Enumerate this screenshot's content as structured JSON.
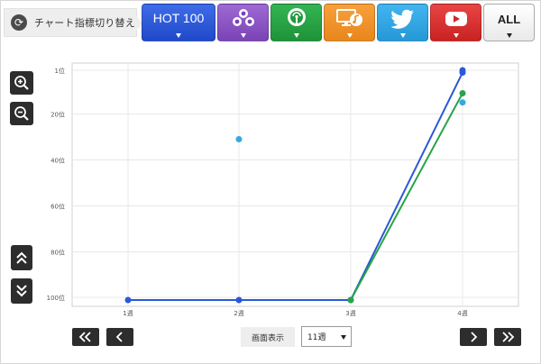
{
  "header": {
    "switch_label": "チャート指標切り替え",
    "tabs": [
      {
        "key": "hot100",
        "label": "HOT 100"
      },
      {
        "key": "person",
        "icon": "people-icon"
      },
      {
        "key": "radio",
        "icon": "radio-antenna-icon"
      },
      {
        "key": "pc",
        "icon": "pc-music-icon"
      },
      {
        "key": "twitter",
        "icon": "twitter-bird-icon"
      },
      {
        "key": "youtube",
        "icon": "youtube-play-icon"
      },
      {
        "key": "all",
        "label": "ALL"
      }
    ],
    "colors": {
      "hot100": "#2a58d8",
      "person": "#8a55c4",
      "radio": "#27a446",
      "pc": "#f09330",
      "twitter": "#34a8e4",
      "youtube": "#d73333"
    }
  },
  "controls": {
    "display_label": "画面表示",
    "display_value": "11週",
    "zoom_in_icon": "zoom-in-icon",
    "zoom_out_icon": "zoom-out-icon",
    "scroll_up_icon": "double-chevron-up-icon",
    "scroll_down_icon": "double-chevron-down-icon"
  },
  "chart_data": {
    "type": "line",
    "categories": [
      "1週",
      "2週",
      "3週",
      "4週"
    ],
    "y_ticks": [
      1,
      20,
      40,
      60,
      80,
      100
    ],
    "y_tick_labels": [
      "1位",
      "20位",
      "40位",
      "60位",
      "80位",
      "100位"
    ],
    "ylim": [
      100,
      1
    ],
    "y_inverted": true,
    "grid": true,
    "legend": "none",
    "series": [
      {
        "color": "#2a58d8",
        "line": true,
        "values": [
          101,
          101,
          101,
          2
        ]
      },
      {
        "color": "#27a446",
        "line": true,
        "values": [
          null,
          null,
          101,
          11
        ]
      },
      {
        "color": "#34a8e4",
        "line": false,
        "values": [
          null,
          31,
          null,
          15
        ]
      },
      {
        "color": "#2a58d8",
        "line": false,
        "values": [
          null,
          null,
          null,
          1
        ]
      }
    ]
  }
}
